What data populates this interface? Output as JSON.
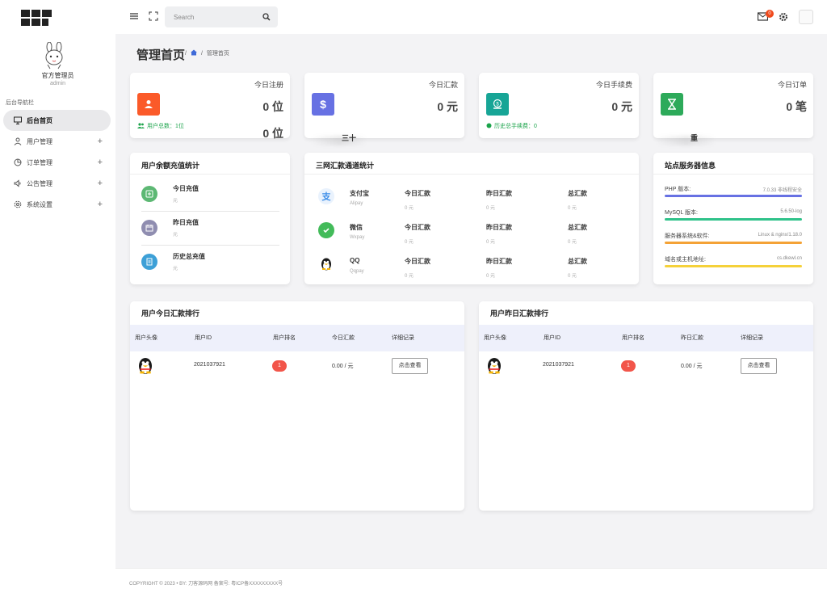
{
  "logo": {
    "alt": "刀客源码网"
  },
  "user": {
    "name": "官方管理员",
    "role": "admin"
  },
  "nav": {
    "title": "后台导航栏",
    "items": [
      {
        "label": "后台首页",
        "icon": "monitor-icon"
      },
      {
        "label": "用户管理",
        "icon": "user-icon"
      },
      {
        "label": "订单管理",
        "icon": "pie-icon"
      },
      {
        "label": "公告管理",
        "icon": "speaker-icon"
      },
      {
        "label": "系统设置",
        "icon": "gear-icon"
      }
    ]
  },
  "topbar": {
    "search_placeholder": "Search",
    "mail_count": "0"
  },
  "page": {
    "title": "管理首页",
    "breadcrumb_current": "管理首页"
  },
  "stats": [
    {
      "title": "今日注册",
      "value": "0 位",
      "sub": "用户总数：1位",
      "value2": "0 位",
      "color": "#fb5a29"
    },
    {
      "title": "今日汇款",
      "value": "0 元",
      "color": "#6771e3"
    },
    {
      "title": "今日手续费",
      "value": "0 元",
      "sub": "历史总手续费：0",
      "color": "#17a596"
    },
    {
      "title": "今日订单",
      "value": "0 笔",
      "color": "#2daa5a"
    }
  ],
  "fragments": {
    "f1": "三十",
    "f2": "重"
  },
  "recharge": {
    "title": "用户余额充值统计",
    "rows": [
      {
        "label": "今日充值",
        "value": "元",
        "color": "#5db874"
      },
      {
        "label": "昨日充值",
        "value": "元",
        "color": "#8f8db0"
      },
      {
        "label": "历史总充值",
        "value": "元",
        "color": "#3da0d7"
      }
    ]
  },
  "channels": {
    "title": "三网汇款通道统计",
    "col_labels": [
      "今日汇款",
      "昨日汇款",
      "总汇款"
    ],
    "rows": [
      {
        "name": "支付宝",
        "en": "Alipay",
        "values": [
          "0 元",
          "0 元",
          "0 元"
        ],
        "color": "#3d8ee8"
      },
      {
        "name": "微信",
        "en": "Wxpay",
        "values": [
          "0 元",
          "0 元",
          "0 元"
        ],
        "color": "#43bb5a"
      },
      {
        "name": "QQ",
        "en": "Qqpay",
        "values": [
          "0 元",
          "0 元",
          "0 元"
        ],
        "color": "#222222"
      }
    ]
  },
  "server": {
    "title": "站点服务器信息",
    "rows": [
      {
        "key": "PHP 版本:",
        "value": "7.0.33 非线程安全",
        "color": "#6771e3"
      },
      {
        "key": "MySQL 版本:",
        "value": "5.6.50-log",
        "color": "#2fc28a"
      },
      {
        "key": "服务器系统&软件:",
        "value": "Linux & nginx/1.18.0",
        "color": "#f4a236"
      },
      {
        "key": "域名或主机地址:",
        "value": "cs.dkewl.cn",
        "color": "#f5d13a"
      }
    ]
  },
  "rank_today": {
    "title": "用户今日汇款排行",
    "headers": [
      "用户头像",
      "用户ID",
      "用户排名",
      "今日汇款",
      "详细记录"
    ],
    "row": {
      "id": "2021037921",
      "rank": "1",
      "amount": "0.00 / 元",
      "button": "点击查看"
    }
  },
  "rank_yesterday": {
    "title": "用户昨日汇款排行",
    "headers": [
      "用户头像",
      "用户ID",
      "用户排名",
      "昨日汇款",
      "详细记录"
    ],
    "row": {
      "id": "2021037921",
      "rank": "1",
      "amount": "0.00 / 元",
      "button": "点击查看"
    }
  },
  "footer": {
    "text": "COPYRIGHT © 2023 • BY: 刀客源码网 备案号: 粤ICP备XXXXXXXXX号"
  }
}
